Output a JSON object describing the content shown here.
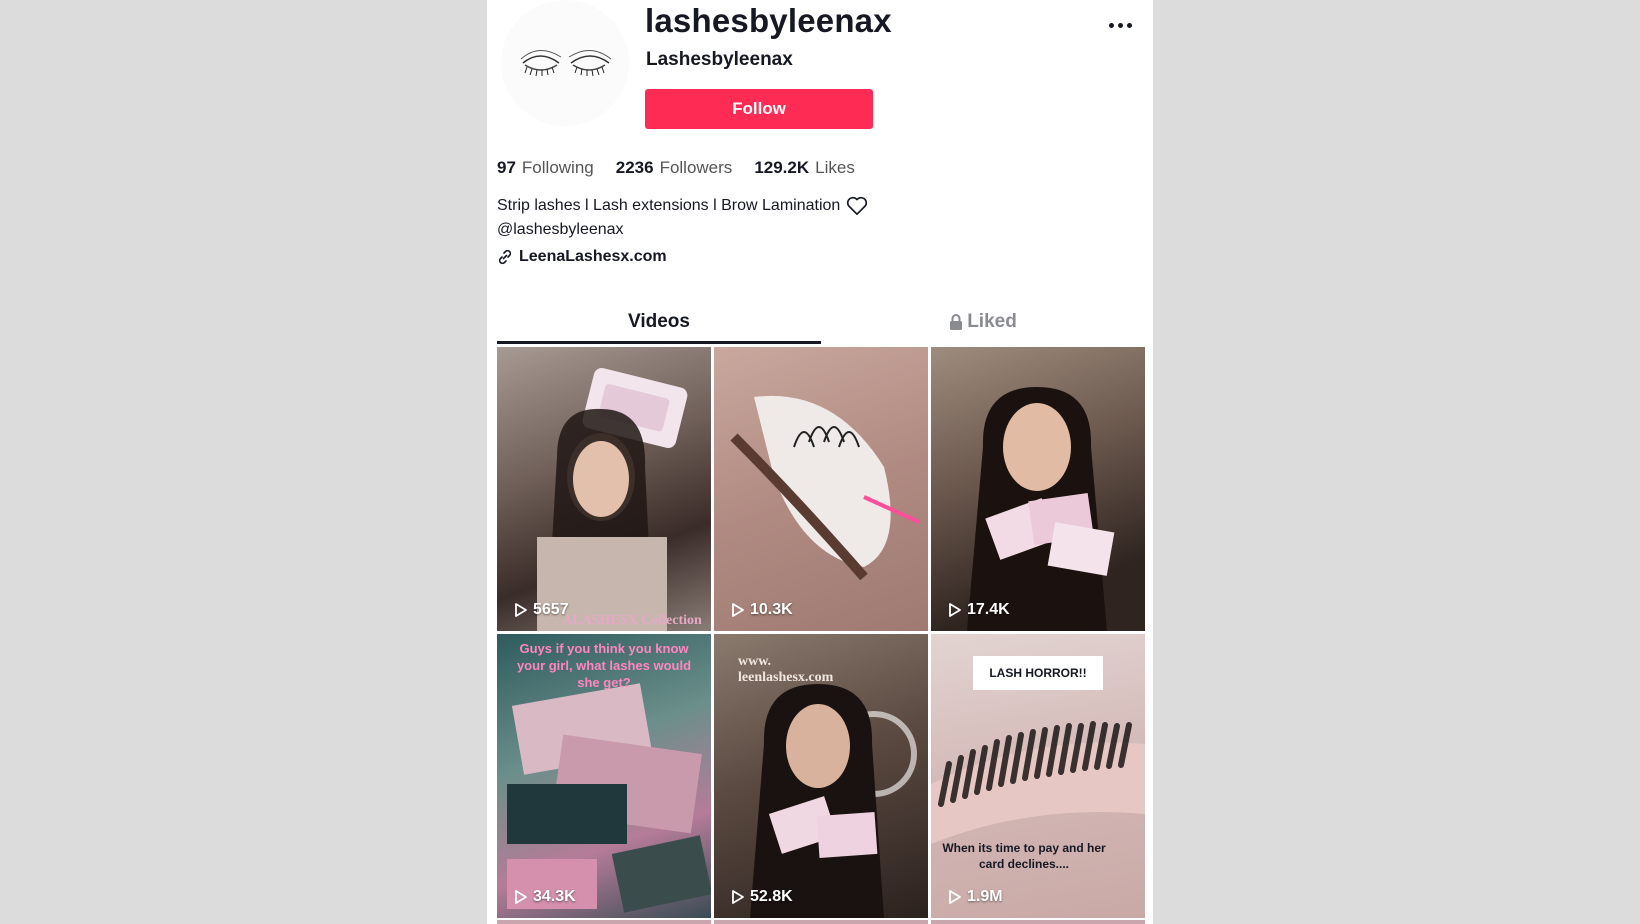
{
  "profile": {
    "username": "lashesbyleenax",
    "nickname": "Lashesbyleenax",
    "follow_label": "Follow",
    "more_icon": "ellipsis-icon"
  },
  "stats": [
    {
      "value": "97",
      "label": "Following"
    },
    {
      "value": "2236",
      "label": "Followers"
    },
    {
      "value": "129.2K",
      "label": "Likes"
    }
  ],
  "bio": {
    "line1": "Strip lashes l Lash extensions l Brow Lamination",
    "line2": "@lashesbyleenax",
    "link": "LeenaLashesx.com"
  },
  "tabs": [
    {
      "label": "Videos",
      "active": true
    },
    {
      "label": "Liked",
      "active": false,
      "icon": "lock-icon"
    }
  ],
  "videos": [
    {
      "views": "5657",
      "overlay": "ALASHESX Collection"
    },
    {
      "views": "10.3K",
      "overlay": ""
    },
    {
      "views": "17.4K",
      "overlay": ""
    },
    {
      "views": "34.3K",
      "overlay": "Guys if you think you know your girl, what lashes would she get?"
    },
    {
      "views": "52.8K",
      "overlay": "www. leenlashesx.com"
    },
    {
      "views": "1.9M",
      "overlay": "LASH HORROR!!",
      "caption": "When its time to pay and her card declines...."
    }
  ],
  "colors": {
    "follow_bg": "#fe2c55",
    "page_bg": "#dcdcdc"
  }
}
